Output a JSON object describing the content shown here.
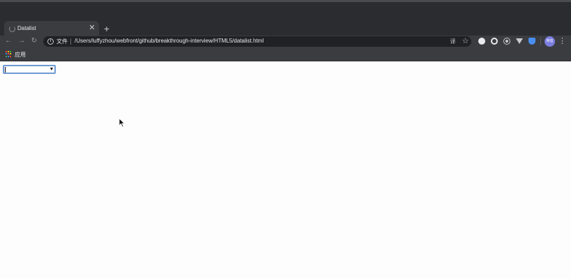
{
  "browser": {
    "tab": {
      "title": "Datalist",
      "close_glyph": "✕",
      "favicon": "page-loading-icon"
    },
    "new_tab_glyph": "+",
    "nav": {
      "back_glyph": "←",
      "forward_glyph": "→",
      "reload_glyph": "↻"
    },
    "omnibox": {
      "scheme_label": "文件",
      "url": "/Users/luffyzhou/webfront/github/breakthrough-interview/HTML5/datalist.html",
      "info_glyph": "i",
      "translate_glyph": "译",
      "star_glyph": "☆"
    },
    "extensions": [
      "circle-extension-icon",
      "ring-extension-icon",
      "target-extension-icon",
      "vue-devtools-icon",
      "shield-extension-icon"
    ],
    "profile": {
      "label": "停息"
    },
    "menu_glyph": "⋮"
  },
  "bookmarks": {
    "apps_label": "应用",
    "apps_colors": [
      "#ea4335",
      "#fbbc05",
      "#34a853",
      "#4285f4",
      "#ea4335",
      "#fbbc05",
      "#34a853",
      "#4285f4",
      "#ea4335"
    ]
  },
  "page": {
    "datalist": {
      "value": "",
      "arrow_glyph": "▼"
    }
  },
  "colors": {
    "chrome_dark": "#2b2c2f",
    "toolbar": "#3b3c3f",
    "omnibox": "#202124",
    "focus_ring": "#6e9ad4",
    "page_bg": "#fdfdfd"
  }
}
